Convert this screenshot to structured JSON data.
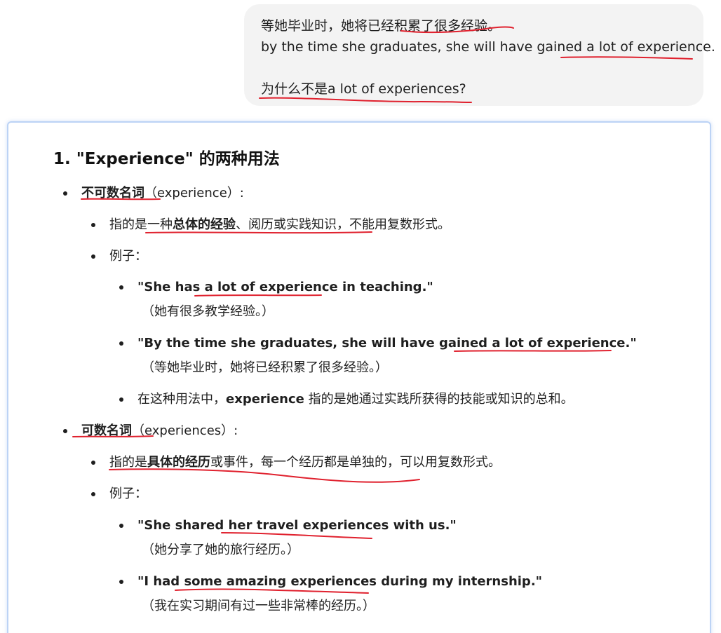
{
  "user_message": {
    "line1": "等她毕业时，她将已经积累了很多经验。",
    "line2": "by the time she graduates, she will have gained a lot of experience.",
    "line3": "为什么不是a lot of experiences?"
  },
  "answer": {
    "heading": "1. \"Experience\" 的两种用法",
    "sections": [
      {
        "term": "不可数名词",
        "term_note": "（experience）:",
        "definition_prefix": "指的是一种",
        "definition_bold": "总体的经验",
        "definition_suffix": "、阅历或实践知识，不能用复数形式。",
        "examples_label": "例子：",
        "examples": [
          {
            "en_a": "\"She has ",
            "en_b": "a lot of experience",
            "en_c": " in teaching.\"",
            "zh": "（她有很多教学经验。）"
          },
          {
            "en_a": "\"By the time she graduates, she will have gained ",
            "en_b": "a lot of experience.\"",
            "en_c": "",
            "zh": "（等她毕业时，她将已经积累了很多经验。）"
          }
        ],
        "note_prefix": "在这种用法中，",
        "note_bold": "experience",
        "note_suffix": " 指的是她通过实践所获得的技能或知识的总和。"
      },
      {
        "term": "可数名词",
        "term_note": "（experiences）:",
        "definition_prefix": "指的是",
        "definition_bold": "具体的经历",
        "definition_suffix": "或事件，每一个经历都是单独的，可以用复数形式。",
        "examples_label": "例子：",
        "examples": [
          {
            "en_a": "\"She shared ",
            "en_b": "her travel experiences",
            "en_c": " with us.\"",
            "zh": "（她分享了她的旅行经历。）"
          },
          {
            "en_a": "\"I had ",
            "en_b": "some amazing experiences",
            "en_c": " during my internship.\"",
            "zh": "（我在实习期间有过一些非常棒的经历。）"
          }
        ]
      }
    ]
  },
  "colors": {
    "bubble_bg": "#f3f3f3",
    "card_border": "#bcd3f5",
    "annotation_red": "#e0212e",
    "text": "#1f1f1f"
  }
}
